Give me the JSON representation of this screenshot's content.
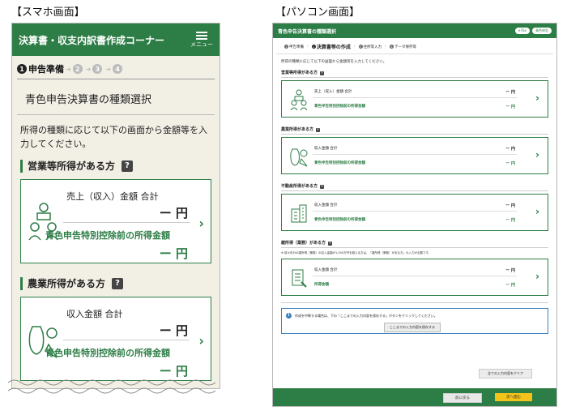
{
  "captions": {
    "phone": "【スマホ画面】",
    "pc": "【パソコン画面】"
  },
  "phone": {
    "header_title": "決算書・収支内訳書作成コーナー",
    "menu_label": "メニュー",
    "steps": {
      "current_num": "1",
      "current_label": "申告準備",
      "s2": "2",
      "s3": "3",
      "s4": "4"
    },
    "section_title": "青色申告決算書の種類選択",
    "intro": "所得の種類に応じて以下の画面から金額等を入力してください。",
    "categories": [
      {
        "title": "営業等所得がある方",
        "help": "?",
        "label1": "売上（収入）金額 合計",
        "value1": "ー 円",
        "label2": "青色申告特別控除前の所得金額",
        "value2": "ー 円"
      },
      {
        "title": "農業所得がある方",
        "help": "?",
        "label1": "収入金額 合計",
        "value1": "ー 円",
        "label2": "青色申告特別控除前の所得金額",
        "value2": "ー 円"
      }
    ]
  },
  "pc": {
    "header_title": "青色申告決算書の種類選択",
    "header_buttons": [
      "e-Tax",
      "青色申告"
    ],
    "steps": [
      {
        "num": "1",
        "label": "申告準備"
      },
      {
        "num": "2",
        "label": "決算書等の作成"
      },
      {
        "num": "3",
        "label": "住所等入力"
      },
      {
        "num": "4",
        "label": "データ保存等"
      }
    ],
    "intro": "所得の種類に応じて以下の画面から金額等を入力してください。",
    "categories": [
      {
        "title": "営業等所得がある方",
        "label1": "売上（収入）金額 合計",
        "value1": "ー 円",
        "label2": "青色申告特別控除前の所得金額",
        "value2": "ー 円"
      },
      {
        "title": "農業所得がある方",
        "label1": "収入金額 合計",
        "value1": "ー 円",
        "label2": "青色申告特別控除前の所得金額",
        "value2": "ー 円"
      },
      {
        "title": "不動産所得がある方",
        "label1": "収入金額 合計",
        "value1": "ー 円",
        "label2": "青色申告特別控除前の所得金額",
        "value2": "ー 円"
      },
      {
        "title": "雑所得（業務）がある方",
        "note": "※ 前々年分の雑所得（業務）の収入金額が1,000万円を超える方は、「雑所得（業務）がある方」の入力が必要です。",
        "label1": "収入金額 合計",
        "value1": "ー 円",
        "label2": "所得金額",
        "value2": "ー 円"
      }
    ],
    "info_text": "作成を中断する場合は、下の「ここまでの入力内容を保存する」ボタンをクリックしてください。",
    "save_button": "ここまでの入力内容を保存する",
    "clear_button": "全ての入力内容をクリア",
    "back_button": "前に戻る",
    "next_button": "次へ進む"
  },
  "colors": {
    "brand_green": "#2d7d46",
    "accent_yellow": "#f3c31a",
    "info_blue": "#3c7fc2"
  }
}
